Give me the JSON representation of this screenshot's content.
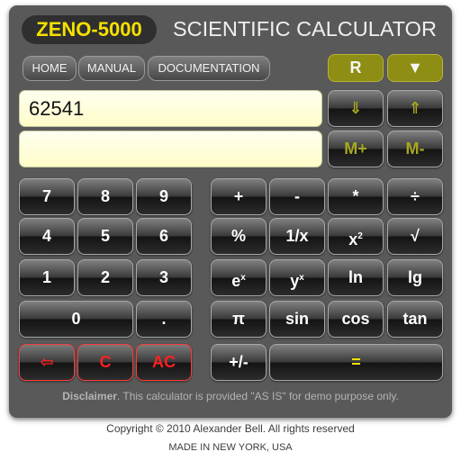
{
  "header": {
    "brand": "ZENO-5000",
    "title": "SCIENTIFIC CALCULATOR"
  },
  "nav": {
    "home": "HOME",
    "manual": "MANUAL",
    "documentation": "DOCUMENTATION",
    "reset": "R",
    "collapse": "▼"
  },
  "displays": {
    "main_value": "62541",
    "memory_value": ""
  },
  "memory_keys": {
    "down": "⇓",
    "up": "⇑",
    "m_plus": "M+",
    "m_minus": "M-"
  },
  "keypad": {
    "d7": "7",
    "d8": "8",
    "d9": "9",
    "d4": "4",
    "d5": "5",
    "d6": "6",
    "d1": "1",
    "d2": "2",
    "d3": "3",
    "d0": "0",
    "dot": ".",
    "backspace": "⇦",
    "clear": "C",
    "all_clear": "AC"
  },
  "operators": {
    "plus": "+",
    "minus": "-",
    "multiply": "*",
    "divide": "÷",
    "percent": "%",
    "reciprocal": "1/x",
    "square_base": "x",
    "square_exp": "2",
    "sqrt": "√",
    "exp_base": "e",
    "exp_exp": "x",
    "power_base": "y",
    "power_exp": "x",
    "ln": "ln",
    "lg": "lg",
    "pi": "π",
    "sin": "sin",
    "cos": "cos",
    "tan": "tan",
    "negate": "+/-",
    "equals": "="
  },
  "footer": {
    "disclaimer_bold": "Disclaimer",
    "disclaimer_text": ". This calculator is provided \"AS IS\" for demo purpose only.",
    "copyright": "Copyright © 2010 Alexander Bell. All rights reserved",
    "made_in": "MADE IN NEW YORK, USA"
  },
  "colors": {
    "panel": "#595959",
    "brand_yellow": "#f5e000",
    "olive_button": "#8e8e14",
    "display_bg": "#fffcc8",
    "danger_red": "#ff2020"
  }
}
